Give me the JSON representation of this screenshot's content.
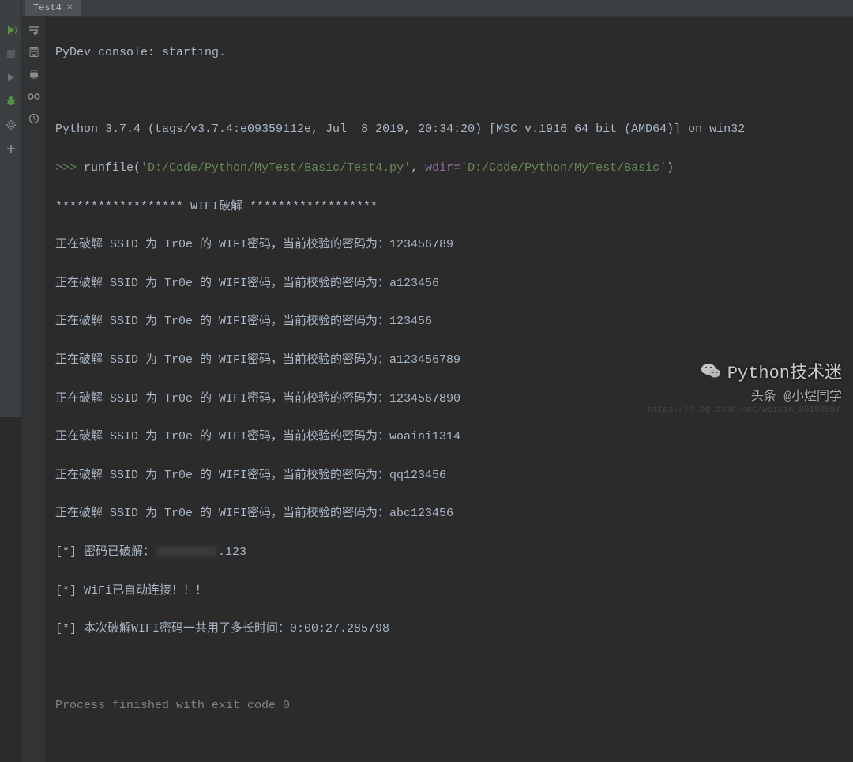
{
  "tab": {
    "label": "Test4"
  },
  "console": {
    "pydev": "PyDev console: starting.",
    "empty": " ",
    "python_ver": "Python 3.7.4 (tags/v3.7.4:e09359112e, Jul  8 2019, 20:34:20) [MSC v.1916 64 bit (AMD64)] on win32",
    "prompt": ">>> ",
    "runfile_fn": "runfile(",
    "runfile_path": "'D:/Code/Python/MyTest/Basic/Test4.py'",
    "runfile_comma": ", ",
    "runfile_kw": "wdir=",
    "runfile_wdir": "'D:/Code/Python/MyTest/Basic'",
    "runfile_end": ")",
    "banner": "****************** WIFI破解 ******************",
    "lines": [
      "正在破解 SSID 为 Tr0e 的 WIFI密码，当前校验的密码为：123456789",
      "正在破解 SSID 为 Tr0e 的 WIFI密码，当前校验的密码为：a123456",
      "正在破解 SSID 为 Tr0e 的 WIFI密码，当前校验的密码为：123456",
      "正在破解 SSID 为 Tr0e 的 WIFI密码，当前校验的密码为：a123456789",
      "正在破解 SSID 为 Tr0e 的 WIFI密码，当前校验的密码为：1234567890",
      "正在破解 SSID 为 Tr0e 的 WIFI密码，当前校验的密码为：woaini1314",
      "正在破解 SSID 为 Tr0e 的 WIFI密码，当前校验的密码为：qq123456",
      "正在破解 SSID 为 Tr0e 的 WIFI密码，当前校验的密码为：abc123456"
    ],
    "cracked_prefix": "[*] 密码已破解：",
    "cracked_suffix": ".123",
    "connected": "[*] WiFi已自动连接！！！",
    "duration": "[*] 本次破解WIFI密码一共用了多长时间：0:00:27.285798",
    "finished": "Process finished with exit code 0"
  },
  "watermark": {
    "line1": "Python技术迷",
    "line2": "头条 @小煜同学",
    "url": "https://blog.csdn.net/weixin_39198897"
  }
}
